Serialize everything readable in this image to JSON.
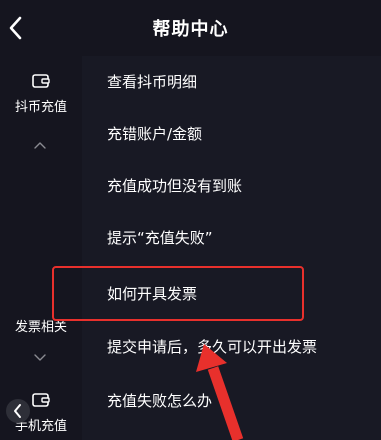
{
  "header": {
    "title": "帮助中心",
    "back_icon": "chevron-left-icon"
  },
  "sidebar": {
    "categories": [
      {
        "label": "抖币充值",
        "icon": "wallet-icon"
      },
      {
        "label": "发票相关"
      },
      {
        "label": "手机充值",
        "icon": "wallet-icon"
      }
    ]
  },
  "items": [
    "查看抖币明细",
    "充错账户/金额",
    "充值成功但没有到账",
    "提示“充值失败”",
    "如何开具发票",
    "提交申请后，多久可以开出发票",
    "充值失败怎么办"
  ],
  "colors": {
    "background": "#15151f",
    "content_background": "#181924",
    "highlight": "#e8302c"
  }
}
